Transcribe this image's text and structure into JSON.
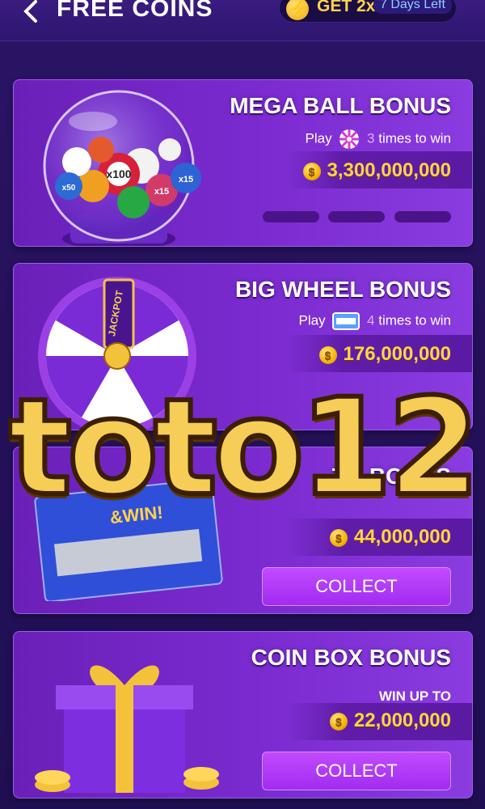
{
  "header": {
    "title": "FREE COINS",
    "promo_label": "GET 2x",
    "promo_days": "7 Days Left"
  },
  "cards": [
    {
      "title": "MEGA BALL BONUS",
      "play_prefix": "Play",
      "times": "3",
      "times_suffix": "times to win",
      "amount": "3,300,000,000"
    },
    {
      "title": "BIG WHEEL BONUS",
      "play_prefix": "Play",
      "times": "4",
      "times_suffix": "times to win",
      "amount": "176,000,000",
      "wheel_label": "JACKPOT"
    },
    {
      "title_fragment": "TO BONUS",
      "amount": "44,000,000",
      "collect_label": "COLLECT",
      "scratch_label": "&WIN!"
    },
    {
      "title": "COIN BOX BONUS",
      "win_up_to": "WIN UP TO",
      "amount": "22,000,000",
      "collect_label": "COLLECT"
    }
  ],
  "ball_labels": [
    "x100",
    "x15",
    "x15",
    "x50"
  ],
  "watermark": "toto12",
  "colors": {
    "card_purple": "#7b2bd0",
    "gold": "#ffd34a",
    "collect_button": "#b13af8",
    "background": "#25115b"
  }
}
